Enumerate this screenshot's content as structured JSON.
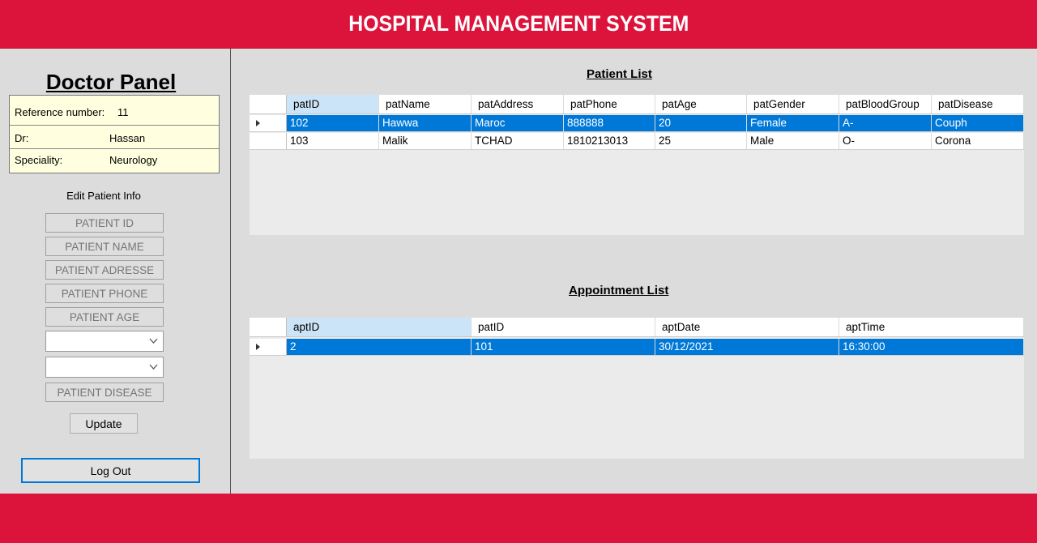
{
  "app_title": "HOSPITAL MANAGEMENT SYSTEM",
  "panel": {
    "title": "Doctor Panel",
    "reference_label": "Reference number:",
    "reference_value": "11",
    "doctor_label": "Dr:",
    "doctor_value": "Hassan",
    "speciality_label": "Speciality:",
    "speciality_value": "Neurology",
    "edit_label": "Edit Patient Info",
    "fields": {
      "patient_id": "PATIENT ID",
      "patient_name": "PATIENT NAME",
      "patient_address": "PATIENT ADRESSE",
      "patient_phone": "PATIENT PHONE",
      "patient_age": "PATIENT AGE",
      "patient_disease": "PATIENT DISEASE"
    },
    "update_button": "Update",
    "logout_button": "Log Out"
  },
  "patient_list": {
    "title": "Patient List",
    "columns": [
      "patID",
      "patName",
      "patAddress",
      "patPhone",
      "patAge",
      "patGender",
      "patBloodGroup",
      "patDisease"
    ],
    "rows": [
      [
        "102",
        "Hawwa",
        "Maroc",
        "888888",
        "20",
        "Female",
        "A-",
        "Couph"
      ],
      [
        "103",
        "Malik",
        "TCHAD",
        "1810213013",
        "25",
        "Male",
        "O-",
        "Corona"
      ]
    ],
    "selected_row": 0
  },
  "appointment_list": {
    "title": "Appointment List",
    "columns": [
      "aptID",
      "patID",
      "aptDate",
      "aptTime"
    ],
    "rows": [
      [
        "2",
        "101",
        "30/12/2021",
        "16:30:00"
      ]
    ],
    "selected_row": 0
  },
  "colors": {
    "brand": "#dc143c",
    "selection": "#0078d7",
    "info_box": "#ffffe0"
  }
}
